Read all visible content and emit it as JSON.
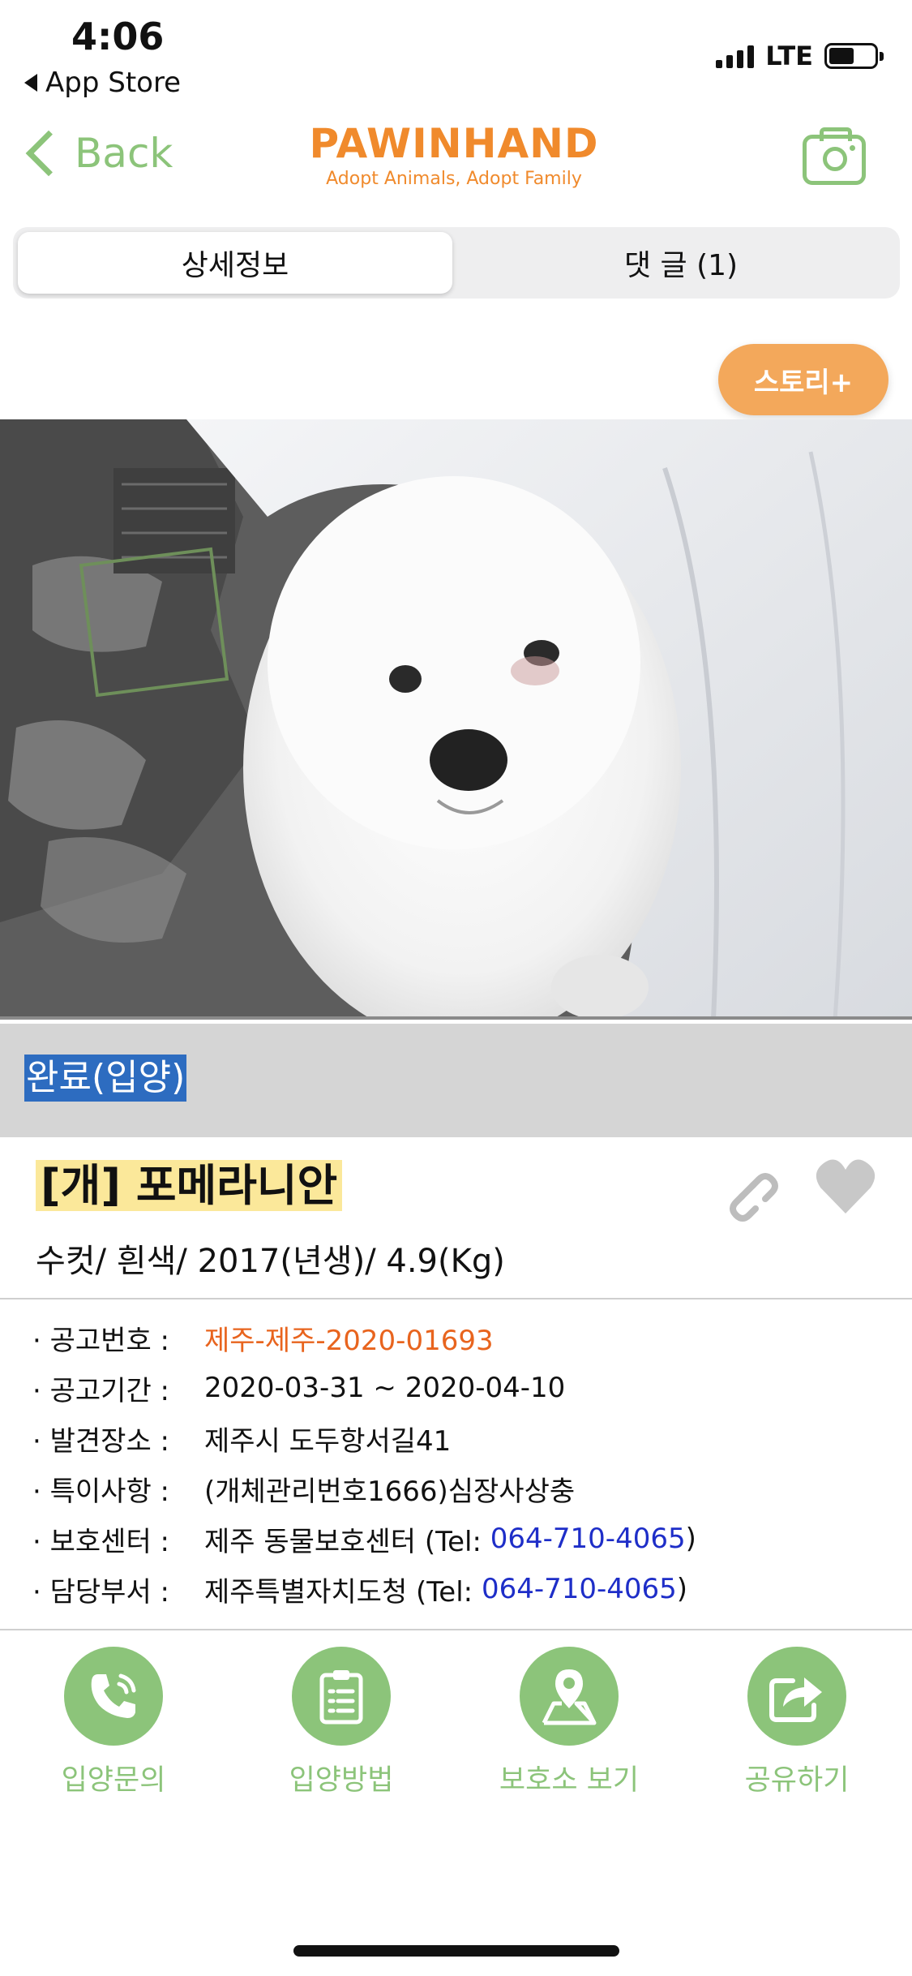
{
  "status_bar": {
    "time": "4:06",
    "back_app": "App Store",
    "network": "LTE",
    "battery_level": 0.55
  },
  "nav": {
    "back_label": "Back",
    "logo_title": "PAWINHAND",
    "logo_subtitle": "Adopt Animals, Adopt Family",
    "camera_icon": "camera-icon",
    "accent_color": "#8cc47a",
    "brand_color": "#f08a2c"
  },
  "tabs": [
    {
      "label": "상세정보",
      "selected": true
    },
    {
      "label": "댓 글 (1)",
      "selected": false
    }
  ],
  "story_button": "스토리+",
  "status_label": "완료(입양)",
  "pet": {
    "title": "[개] 포메라니안",
    "subtitle": "수컷/ 흰색/ 2017(년생)/ 4.9(Kg)"
  },
  "details": [
    {
      "label": "· 공고번호 :",
      "value": "제주-제주-2020-01693"
    },
    {
      "label": "· 공고기간 :",
      "value": "2020-03-31 ~ 2020-04-10"
    },
    {
      "label": "· 발견장소 :",
      "value": "제주시 도두항서길41"
    },
    {
      "label": "· 특이사항 :",
      "value": "(개체관리번호1666)심장사상충"
    },
    {
      "label": "· 보호센터 :",
      "value_prefix": "제주 동물보호센터 (Tel: ",
      "phone": "064-710-4065",
      "value_suffix": ")"
    },
    {
      "label": "· 담당부서 :",
      "value_prefix": "제주특별자치도청 (Tel: ",
      "phone": "064-710-4065",
      "value_suffix": ")"
    }
  ],
  "actions": [
    {
      "label": "입양문의",
      "icon": "phone-icon"
    },
    {
      "label": "입양방법",
      "icon": "clipboard-icon"
    },
    {
      "label": "보호소 보기",
      "icon": "map-pin-icon"
    },
    {
      "label": "공유하기",
      "icon": "share-icon"
    }
  ]
}
